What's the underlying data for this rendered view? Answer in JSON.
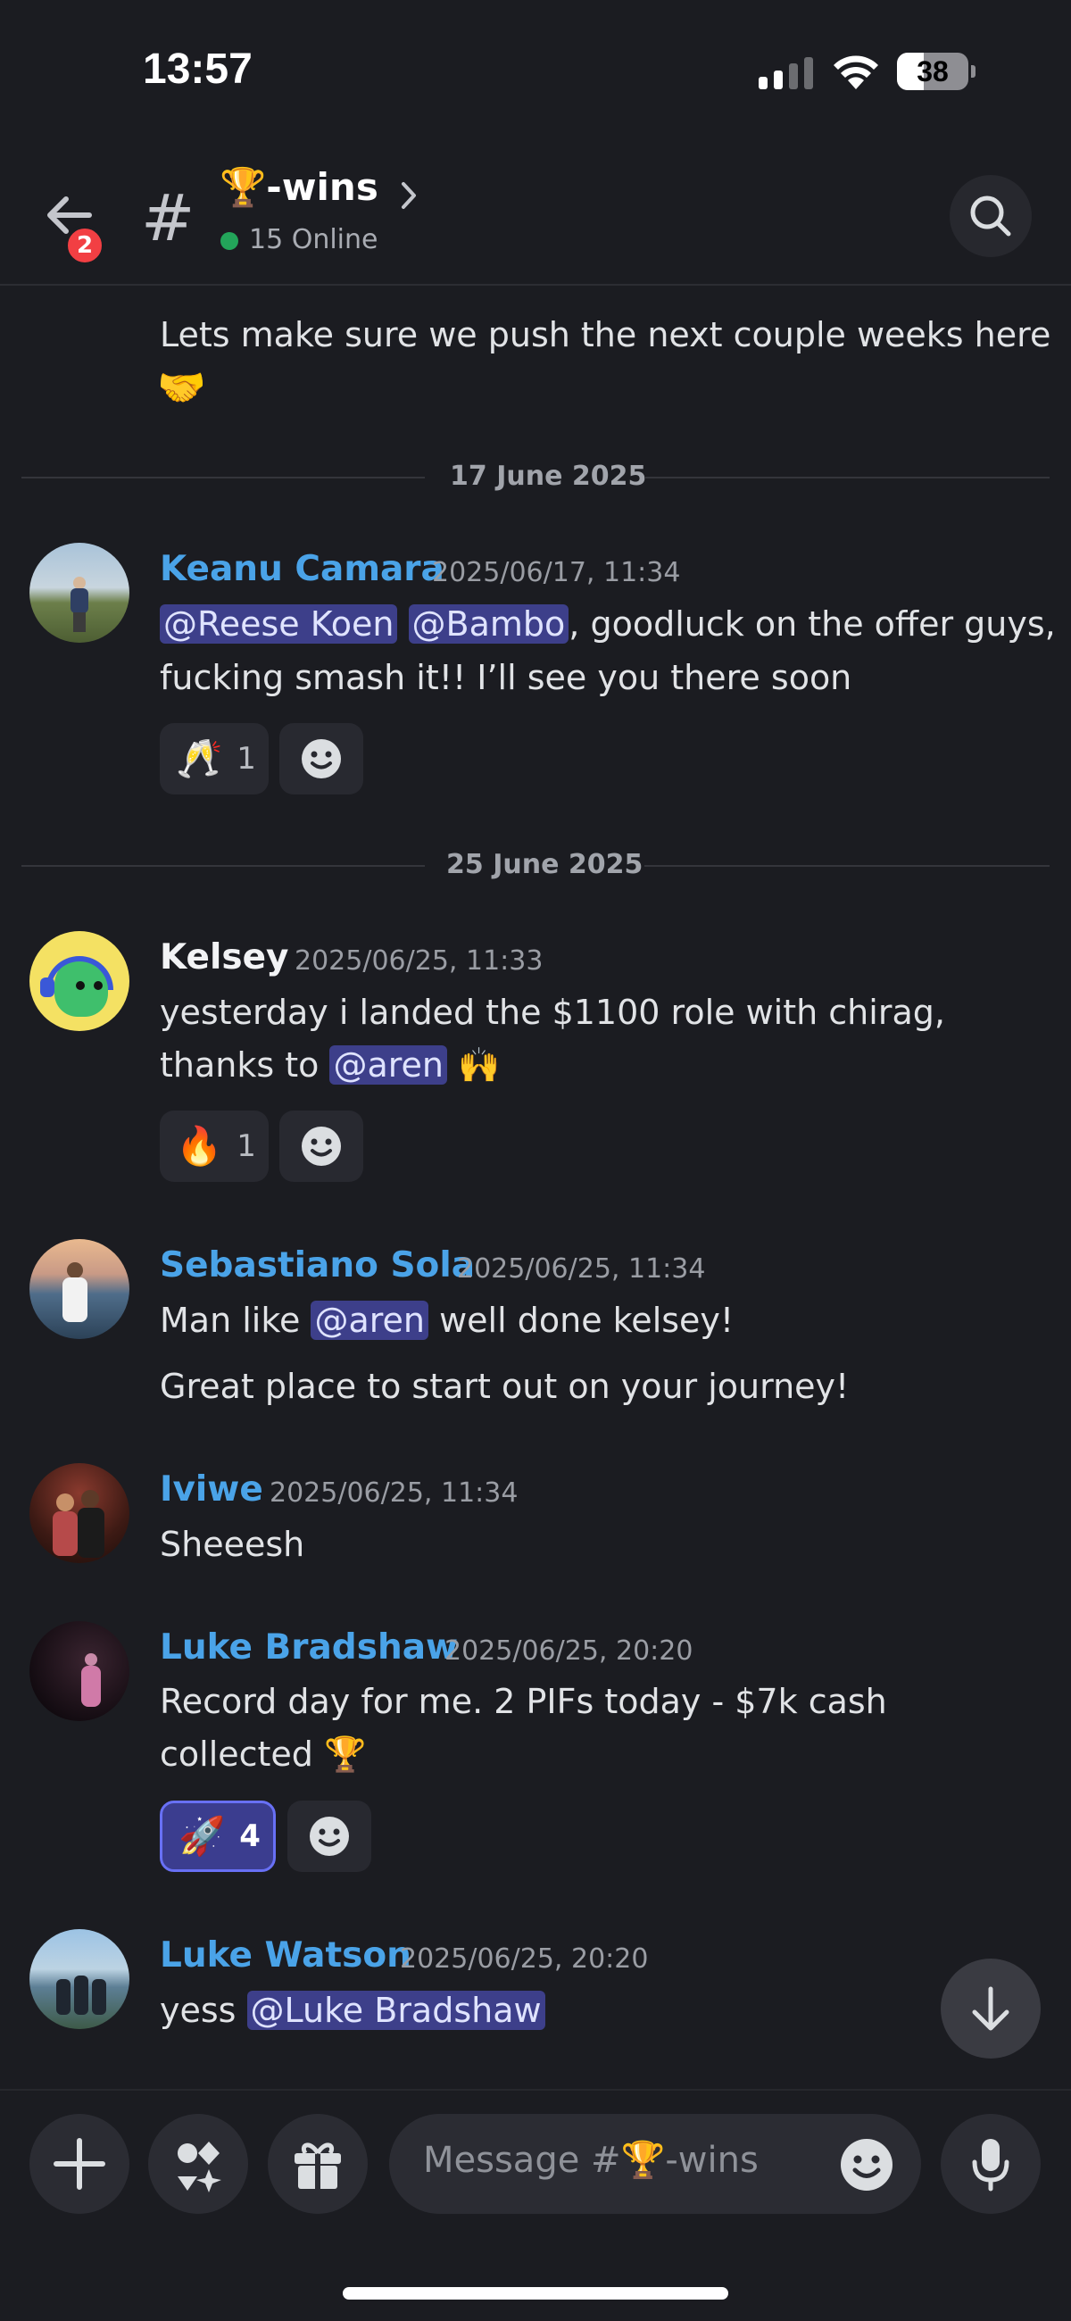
{
  "status_bar": {
    "time": "13:57",
    "battery": "38",
    "battery_level": 0.38
  },
  "header": {
    "back_badge": "2",
    "channel_name": "🏆-wins",
    "online_text": "15 Online"
  },
  "messages": {
    "prev_text_line1": "Lets make sure we push the next couple weeks here",
    "prev_text_line2": "🤝",
    "date1": "17 June 2025",
    "m1": {
      "author": "Keanu Camara",
      "timestamp": "2025/06/17, 11:34",
      "mention1": "@Reese Koen",
      "mention2": "@Bambo",
      "text1_rest": ", goodluck on the offer guys,",
      "text2": "fucking smash it!! I’ll see you there soon",
      "reaction_emoji": "🥂",
      "reaction_count": "1"
    },
    "date2": "25 June 2025",
    "m2": {
      "author": "Kelsey",
      "timestamp": "2025/06/25, 11:33",
      "text1": "yesterday i landed the $1100 role with chirag,",
      "text2_pre": "thanks to ",
      "mention": "@aren",
      "text2_post": " 🙌",
      "reaction_emoji": "🔥",
      "reaction_count": "1"
    },
    "m3": {
      "author": "Sebastiano Sola",
      "timestamp": "2025/06/25, 11:34",
      "text1_pre": "Man like ",
      "mention": "@aren",
      "text1_post": " well done kelsey!",
      "text2": "Great place to start out on your journey!"
    },
    "m4": {
      "author": "Iviwe",
      "timestamp": "2025/06/25, 11:34",
      "text1": "Sheeesh"
    },
    "m5": {
      "author": "Luke Bradshaw",
      "timestamp": "2025/06/25, 20:20",
      "text1": "Record day for me. 2 PIFs today - $7k cash",
      "text2": "collected 🏆",
      "reaction_emoji": "🚀",
      "reaction_count": "4"
    },
    "m6": {
      "author": "Luke Watson",
      "timestamp": "2025/06/25, 20:20",
      "text1_pre": "yess ",
      "mention": "@Luke Bradshaw"
    }
  },
  "composer": {
    "placeholder": "Message #🏆-wins"
  },
  "colors": {
    "background": "#1b1c21",
    "author_blue": "#4aa3e8",
    "mention_bg": "#3d3f8a",
    "online_green": "#23a55a",
    "badge_red": "#f23f43"
  },
  "icons": [
    "back-arrow-icon",
    "hash-icon",
    "chevron-right-icon",
    "search-icon",
    "smile-add-icon",
    "arrow-down-icon",
    "plus-icon",
    "apps-icon",
    "gift-icon",
    "emoji-icon",
    "microphone-icon"
  ]
}
